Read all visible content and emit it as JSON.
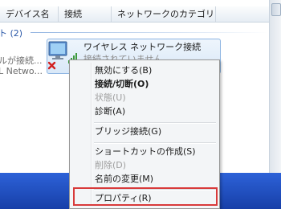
{
  "columns": [
    "デバイス名",
    "接続",
    "ネットワークのカテゴリ"
  ],
  "group": {
    "label": "ト (2)"
  },
  "left_items": [
    "ルが接続...",
    "L Netwo..."
  ],
  "selected_item": {
    "name": "ワイヤレス ネットワーク接続",
    "status": "接続されていません"
  },
  "context_menu": {
    "items": [
      {
        "label": "無効にする(B)",
        "style": "normal"
      },
      {
        "label": "接続/切断(O)",
        "style": "bold"
      },
      {
        "label": "状態(U)",
        "style": "disabled"
      },
      {
        "label": "診断(A)",
        "style": "normal"
      },
      {
        "label": "ブリッジ接続(G)",
        "style": "normal"
      },
      {
        "label": "ショートカットの作成(S)",
        "style": "normal"
      },
      {
        "label": "削除(D)",
        "style": "disabled"
      },
      {
        "label": "名前の変更(M)",
        "style": "normal"
      },
      {
        "label": "プロパティ(R)",
        "style": "normal",
        "highlighted": true
      }
    ]
  },
  "colors": {
    "highlight_border": "#d83a3a",
    "group_label": "#2a58a8",
    "taskbar": "#2d62d8"
  }
}
